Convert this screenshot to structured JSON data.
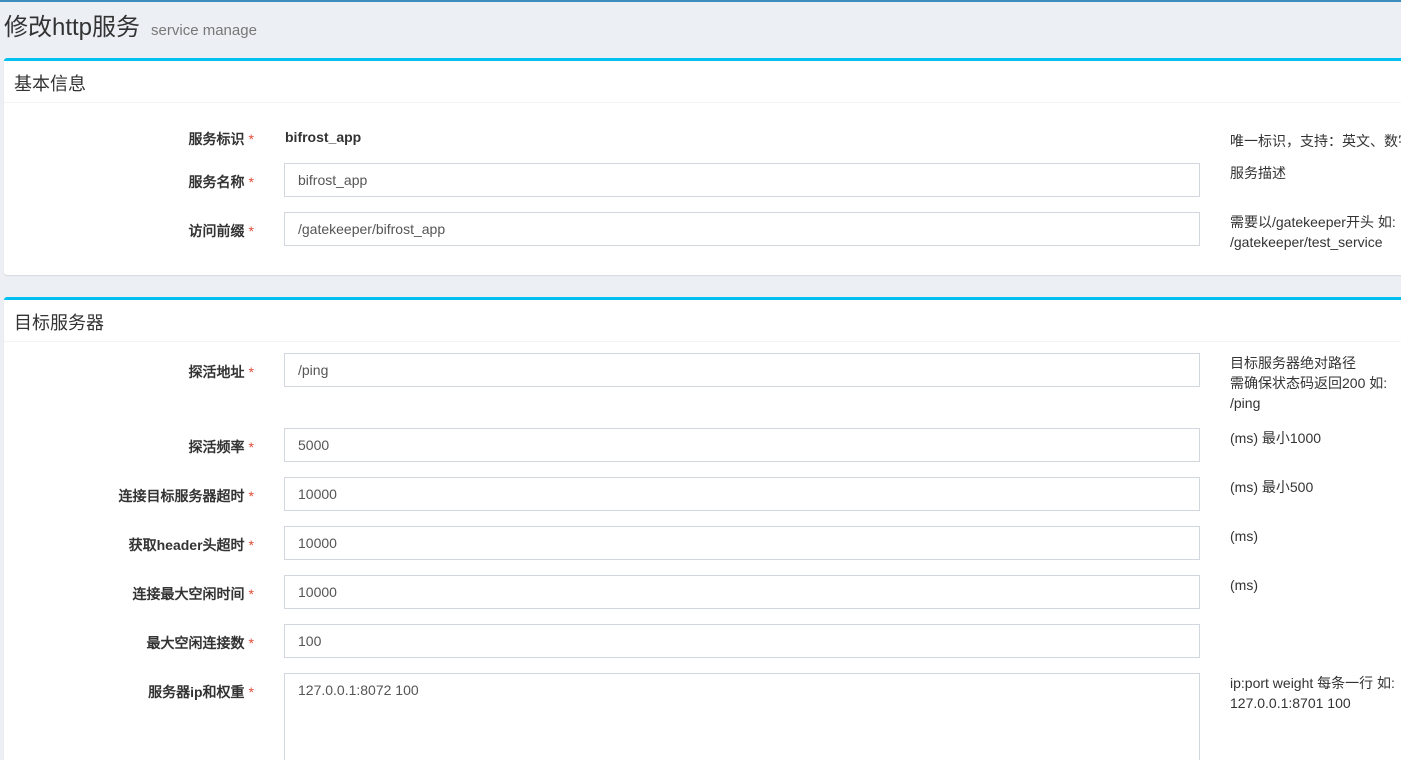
{
  "header": {
    "title": "修改http服务",
    "subtitle": "service manage"
  },
  "basic_info": {
    "title": "基本信息",
    "fields": {
      "service_id": {
        "label": "服务标识",
        "required": "*",
        "value": "bifrost_app",
        "help_1": "唯一标识，支持：英文、数字"
      },
      "service_name": {
        "label": "服务名称",
        "required": "*",
        "value": "bifrost_app",
        "help_1": "服务描述"
      },
      "access_prefix": {
        "label": "访问前缀",
        "required": "*",
        "value": "/gatekeeper/bifrost_app",
        "help_1": "需要以/gatekeeper开头 如:",
        "help_2": "/gatekeeper/test_service"
      }
    }
  },
  "target_server": {
    "title": "目标服务器",
    "fields": {
      "probe_address": {
        "label": "探活地址",
        "required": "*",
        "value": "/ping",
        "help_1": "目标服务器绝对路径",
        "help_2": "需确保状态码返回200 如:",
        "help_3": "/ping"
      },
      "probe_frequency": {
        "label": "探活频率",
        "required": "*",
        "value": "5000",
        "help_1": "(ms) 最小1000"
      },
      "connect_timeout": {
        "label": "连接目标服务器超时",
        "required": "*",
        "value": "10000",
        "help_1": "(ms) 最小500"
      },
      "header_timeout": {
        "label": "获取header头超时",
        "required": "*",
        "value": "10000",
        "help_1": "(ms)"
      },
      "idle_time": {
        "label": "连接最大空闲时间",
        "required": "*",
        "value": "10000",
        "help_1": "(ms)"
      },
      "max_idle_conns": {
        "label": "最大空闲连接数",
        "required": "*",
        "value": "100"
      },
      "ip_weight": {
        "label": "服务器ip和权重",
        "required": "*",
        "value": "127.0.0.1:8072 100",
        "help_1": "ip:port weight 每条一行 如:",
        "help_2": "127.0.0.1:8701 100"
      }
    }
  }
}
